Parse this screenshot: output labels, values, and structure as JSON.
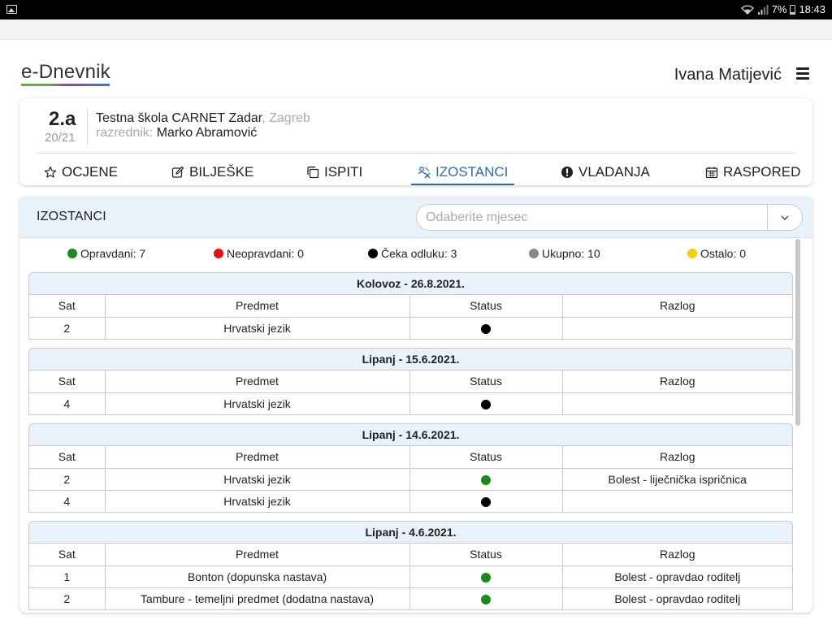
{
  "statusbar": {
    "battery": "7%",
    "time": "18:43"
  },
  "header": {
    "brand": "e-Dnevnik",
    "user": "Ivana Matijević"
  },
  "class_info": {
    "class_name": "2.a",
    "year": "20/21",
    "school": "Testna škola CARNET Zadar",
    "city": ", Zagreb",
    "teacher_label": "razrednik:",
    "teacher": "Marko Abramović"
  },
  "tabs": [
    {
      "label": "OCJENE",
      "icon": "star-icon"
    },
    {
      "label": "BILJEŠKE",
      "icon": "edit-icon"
    },
    {
      "label": "ISPITI",
      "icon": "copy-icon"
    },
    {
      "label": "IZOSTANCI",
      "icon": "absence-icon",
      "active": true
    },
    {
      "label": "VLADANJA",
      "icon": "exclamation-icon"
    },
    {
      "label": "RASPORED",
      "icon": "calendar-icon"
    }
  ],
  "absences": {
    "title": "IZOSTANCI",
    "month_placeholder": "Odaberite mjesec",
    "legend": [
      {
        "label": "Opravdani: 7",
        "color": "#1a8a1a"
      },
      {
        "label": "Neopravdani: 0",
        "color": "#e81010"
      },
      {
        "label": "Čeka odluku: 3",
        "color": "#000000"
      },
      {
        "label": "Ukupno: 10",
        "color": "#888888"
      },
      {
        "label": "Ostalo: 0",
        "color": "#f0d000"
      }
    ],
    "columns": {
      "sat": "Sat",
      "predmet": "Predmet",
      "status": "Status",
      "razlog": "Razlog"
    },
    "days": [
      {
        "title": "Kolovoz - 26.8.2021.",
        "rows": [
          {
            "sat": "2",
            "predmet": "Hrvatski jezik",
            "status_color": "#000000",
            "razlog": ""
          }
        ]
      },
      {
        "title": "Lipanj - 15.6.2021.",
        "rows": [
          {
            "sat": "4",
            "predmet": "Hrvatski jezik",
            "status_color": "#000000",
            "razlog": ""
          }
        ]
      },
      {
        "title": "Lipanj - 14.6.2021.",
        "rows": [
          {
            "sat": "2",
            "predmet": "Hrvatski jezik",
            "status_color": "#1a8a1a",
            "razlog": "Bolest - liječnička ispričnica"
          },
          {
            "sat": "4",
            "predmet": "Hrvatski jezik",
            "status_color": "#000000",
            "razlog": ""
          }
        ]
      },
      {
        "title": "Lipanj - 4.6.2021.",
        "rows": [
          {
            "sat": "1",
            "predmet": "Bonton (dopunska nastava)",
            "status_color": "#1a8a1a",
            "razlog": "Bolest - opravdao roditelj"
          },
          {
            "sat": "2",
            "predmet": "Tambure - temeljni predmet (dodatna nastava)",
            "status_color": "#1a8a1a",
            "razlog": "Bolest - opravdao roditelj"
          }
        ]
      }
    ]
  }
}
